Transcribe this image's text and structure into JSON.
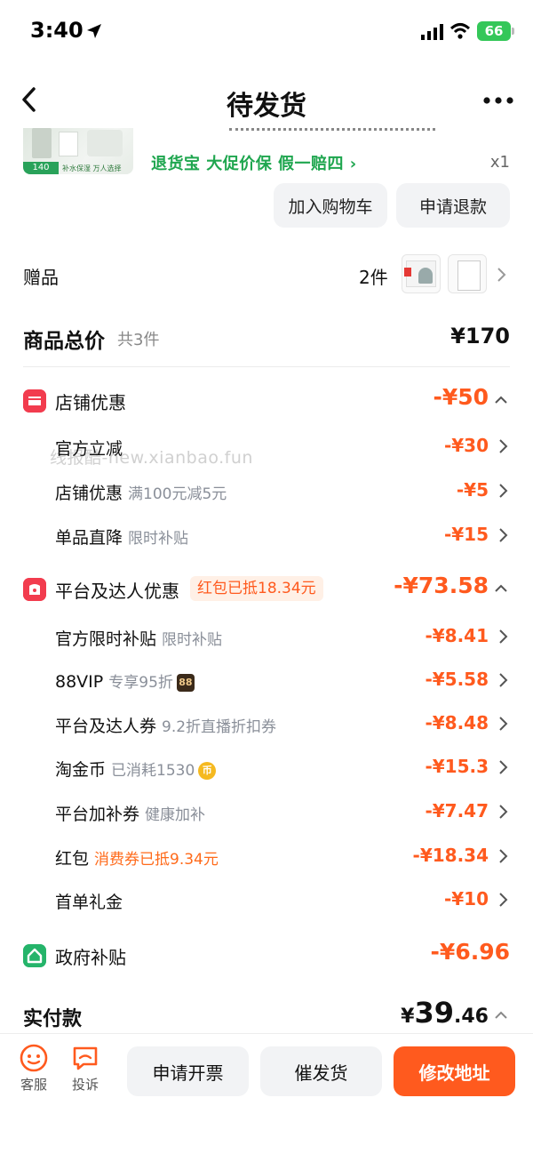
{
  "status_bar": {
    "time": "3:40",
    "battery": "66"
  },
  "nav": {
    "title": "待发货"
  },
  "product": {
    "thumb_price": "140",
    "thumb_sub": "补水保湿 万人选择",
    "guarantees": "退货宝  大促价保  假一赔四 ›",
    "quantity": "x1"
  },
  "actions": {
    "add_to_cart": "加入购物车",
    "refund": "申请退款"
  },
  "gifts": {
    "label": "赠品",
    "count": "2件"
  },
  "total": {
    "label": "商品总价",
    "sub": "共3件",
    "value": "¥170"
  },
  "watermark": "线报酷-new.xianbao.fun",
  "store_discount": {
    "label": "店铺优惠",
    "value": "-¥50",
    "items": [
      {
        "label": "官方立减",
        "sub": "",
        "value": "-¥30"
      },
      {
        "label": "店铺优惠",
        "sub": "满100元减5元",
        "value": "-¥5"
      },
      {
        "label": "单品直降",
        "sub": "限时补贴",
        "value": "-¥15"
      }
    ]
  },
  "platform_discount": {
    "label": "平台及达人优惠",
    "tag": "红包已抵18.34元",
    "value": "-¥73.58",
    "items": [
      {
        "label": "官方限时补贴",
        "sub": "限时补贴",
        "value": "-¥8.41"
      },
      {
        "label": "88VIP",
        "sub": "专享95折",
        "icon": "88",
        "value": "-¥5.58"
      },
      {
        "label": "平台及达人券",
        "sub": "9.2折直播折扣券",
        "value": "-¥8.48"
      },
      {
        "label": "淘金币",
        "sub": "已消耗1530",
        "icon": "币",
        "value": "-¥15.3"
      },
      {
        "label": "平台加补券",
        "sub": "健康加补",
        "value": "-¥7.47"
      },
      {
        "label": "红包",
        "sub": "消费券已抵9.34元",
        "value": "-¥18.34"
      },
      {
        "label": "首单礼金",
        "sub": "",
        "value": "-¥10"
      }
    ]
  },
  "gov_subsidy": {
    "label": "政府补贴",
    "value": "-¥6.96"
  },
  "paid": {
    "label": "实付款",
    "currency": "¥",
    "integer": "39",
    "decimal": ".46"
  },
  "bottom": {
    "service": "客服",
    "complain": "投诉",
    "invoice": "申请开票",
    "urge": "催发货",
    "change_address": "修改地址"
  },
  "colors": {
    "accent": "#ff5a1e",
    "green": "#1fa64f",
    "red_badge": "#f23c4e"
  }
}
